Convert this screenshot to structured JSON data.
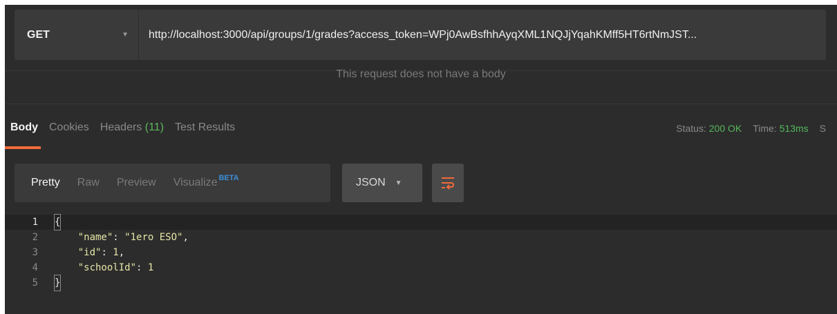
{
  "request": {
    "method": "GET",
    "url": "http://localhost:3000/api/groups/1/grades?access_token=WPj0AwBsfhhAyqXML1NQJjYqahKMff5HT6rtNmJST...",
    "body_message": "This request does not have a body"
  },
  "response_tabs": [
    {
      "label": "Body"
    },
    {
      "label": "Cookies"
    },
    {
      "label": "Headers",
      "count": "(11)"
    },
    {
      "label": "Test Results"
    }
  ],
  "status": {
    "status_label": "Status:",
    "status_value": "200 OK",
    "time_label": "Time:",
    "time_value": "513ms",
    "size_label_partial": "S"
  },
  "format_tabs": [
    {
      "label": "Pretty"
    },
    {
      "label": "Raw"
    },
    {
      "label": "Preview"
    },
    {
      "label": "Visualize",
      "badge": "BETA"
    }
  ],
  "format_select": {
    "value": "JSON"
  },
  "code": {
    "line_numbers": [
      "1",
      "2",
      "3",
      "4",
      "5"
    ],
    "open_brace": "{",
    "close_brace": "}",
    "fields": [
      {
        "key": "\"name\"",
        "value": "\"1ero ESO\"",
        "trail": ","
      },
      {
        "key": "\"id\"",
        "value": "1",
        "trail": ","
      },
      {
        "key": "\"schoolId\"",
        "value": "1",
        "trail": ""
      }
    ]
  },
  "colors": {
    "accent": "#f26b3a",
    "status_ok": "#55b85c",
    "beta": "#3a8fd9",
    "background": "#2c2c2c"
  }
}
